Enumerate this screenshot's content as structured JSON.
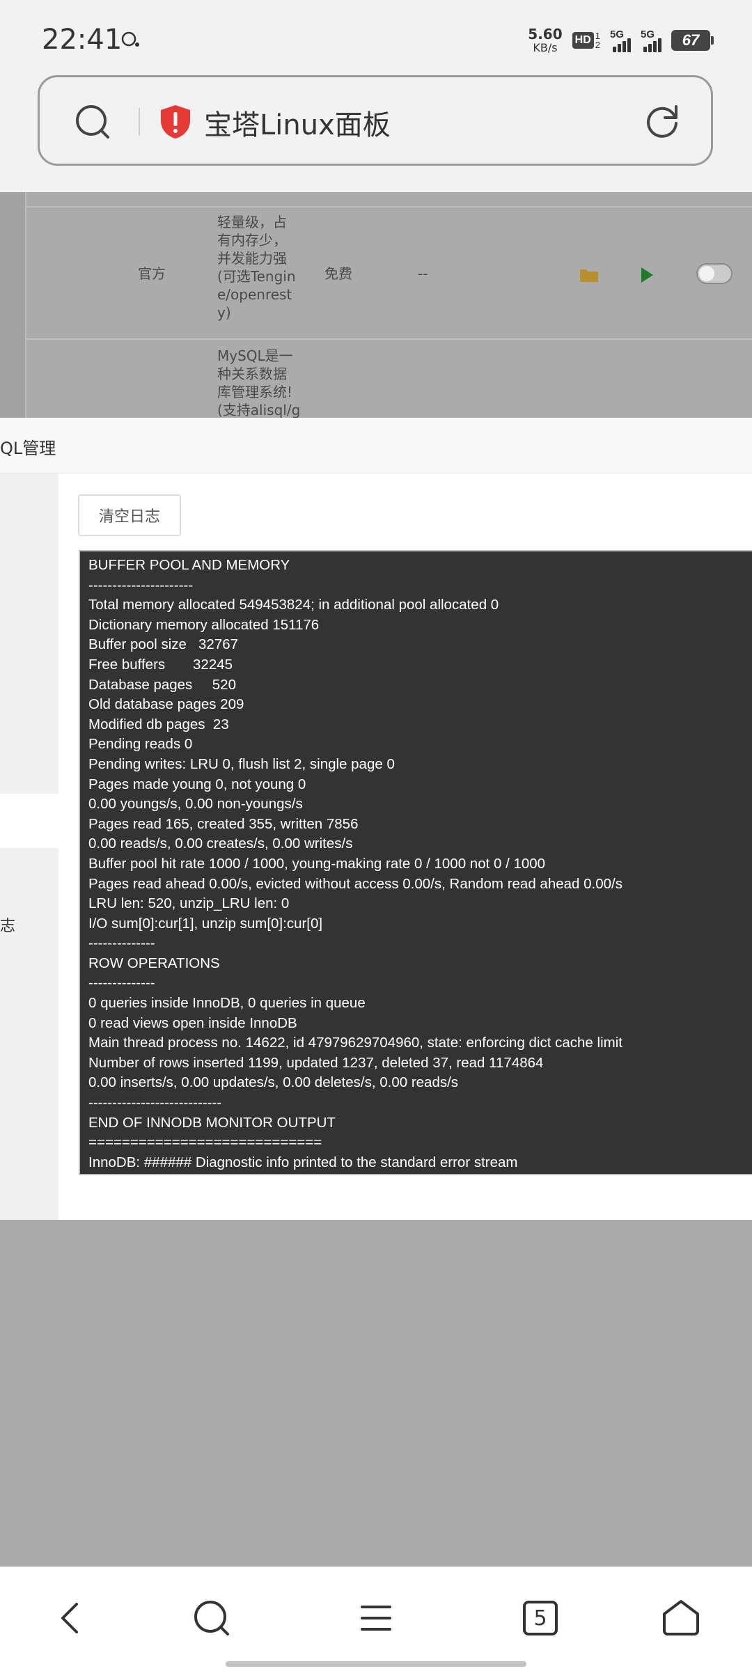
{
  "status_bar": {
    "time": "22:41",
    "net_speed_value": "5.60",
    "net_speed_unit": "KB/s",
    "hd_label": "HD",
    "hd_sub_top": "1",
    "hd_sub_bottom": "2",
    "signal1_label": "5G",
    "signal2_label": "5G",
    "battery": "67"
  },
  "address_bar": {
    "site_title": "宝塔Linux面板",
    "security_color": "#e53935"
  },
  "background_table": {
    "row1": {
      "source": "官方",
      "description": [
        "轻量级，占",
        "有内存少，",
        "并发能力强",
        "(可选Tengin",
        "e/openrest",
        "y)"
      ],
      "price": "免费",
      "expire": "--"
    },
    "row2": {
      "description": [
        "MySQL是一",
        "种关系数据",
        "库管理系统!",
        "(支持alisql/g"
      ]
    }
  },
  "modal": {
    "title": "QL管理",
    "sidebar_partial_label": "志",
    "clear_log_button": "清空日志",
    "log_lines": [
      "BUFFER POOL AND MEMORY",
      "----------------------",
      "Total memory allocated 549453824; in additional pool allocated 0",
      "Dictionary memory allocated 151176",
      "Buffer pool size   32767",
      "Free buffers       32245",
      "Database pages     520",
      "Old database pages 209",
      "Modified db pages  23",
      "Pending reads 0",
      "Pending writes: LRU 0, flush list 2, single page 0",
      "Pages made young 0, not young 0",
      "0.00 youngs/s, 0.00 non-youngs/s",
      "Pages read 165, created 355, written 7856",
      "0.00 reads/s, 0.00 creates/s, 0.00 writes/s",
      "Buffer pool hit rate 1000 / 1000, young-making rate 0 / 1000 not 0 / 1000",
      "Pages read ahead 0.00/s, evicted without access 0.00/s, Random read ahead 0.00/s",
      "LRU len: 520, unzip_LRU len: 0",
      "I/O sum[0]:cur[1], unzip sum[0]:cur[0]",
      "--------------",
      "ROW OPERATIONS",
      "--------------",
      "0 queries inside InnoDB, 0 queries in queue",
      "0 read views open inside InnoDB",
      "Main thread process no. 14622, id 47979629704960, state: enforcing dict cache limit",
      "Number of rows inserted 1199, updated 1237, deleted 37, read 1174864",
      "0.00 inserts/s, 0.00 updates/s, 0.00 deletes/s, 0.00 reads/s",
      "----------------------------",
      "END OF INNODB MONITOR OUTPUT",
      "============================",
      "InnoDB: ###### Diagnostic info printed to the standard error stream"
    ]
  },
  "bottom_nav": {
    "tab_count": "5",
    "icons": [
      "back-icon",
      "search-icon",
      "menu-icon",
      "tabs-icon",
      "home-icon"
    ]
  }
}
